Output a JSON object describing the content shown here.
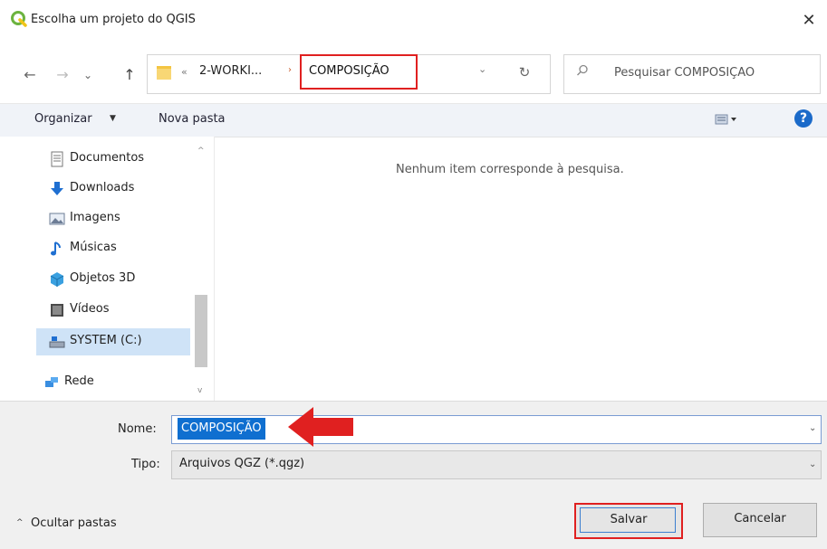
{
  "window": {
    "title": "Escolha um projeto do QGIS",
    "close_glyph": "✕",
    "app_icon": "qgis-icon"
  },
  "nav": {
    "back_glyph": "←",
    "forward_glyph": "→",
    "recent_glyph": "⌄",
    "up_glyph": "↑",
    "breadcrumb_overflow": "«",
    "breadcrumb": [
      "2-WORKI...",
      "COMPOSIÇÃO"
    ],
    "breadcrumb_sep": "›",
    "dropdown_glyph": "⌄",
    "refresh_glyph": "↻",
    "search_placeholder": "Pesquisar COMPOSIÇÃO",
    "search_icon": "search-icon"
  },
  "toolbar": {
    "organize_label": "Organizar",
    "organize_caret": "▼",
    "new_folder_label": "Nova pasta",
    "help_glyph": "?"
  },
  "sidebar": {
    "items": [
      {
        "label": "Documentos",
        "icon": "documents-icon"
      },
      {
        "label": "Downloads",
        "icon": "downloads-icon"
      },
      {
        "label": "Imagens",
        "icon": "pictures-icon"
      },
      {
        "label": "Músicas",
        "icon": "music-icon"
      },
      {
        "label": "Objetos 3D",
        "icon": "objects3d-icon"
      },
      {
        "label": "Vídeos",
        "icon": "videos-icon"
      },
      {
        "label": "SYSTEM (C:)",
        "icon": "drive-icon",
        "selected": true
      },
      {
        "label": "Rede",
        "icon": "network-icon"
      }
    ],
    "scroll_up_glyph": "^",
    "scroll_down_glyph": "v"
  },
  "main": {
    "empty_message": "Nenhum item corresponde à pesquisa."
  },
  "form": {
    "name_label": "Nome:",
    "name_value": "COMPOSIÇÃO",
    "type_label": "Tipo:",
    "type_value": "Arquivos QGZ (*.qgz)",
    "dropdown_glyph": "⌄"
  },
  "footer": {
    "hide_folders_label": "Ocultar pastas",
    "hide_folders_caret": "^",
    "save_label": "Salvar",
    "cancel_label": "Cancelar"
  },
  "colors": {
    "highlight": "#e02020",
    "selection": "#0f6fd0",
    "help": "#1b6ac9"
  }
}
